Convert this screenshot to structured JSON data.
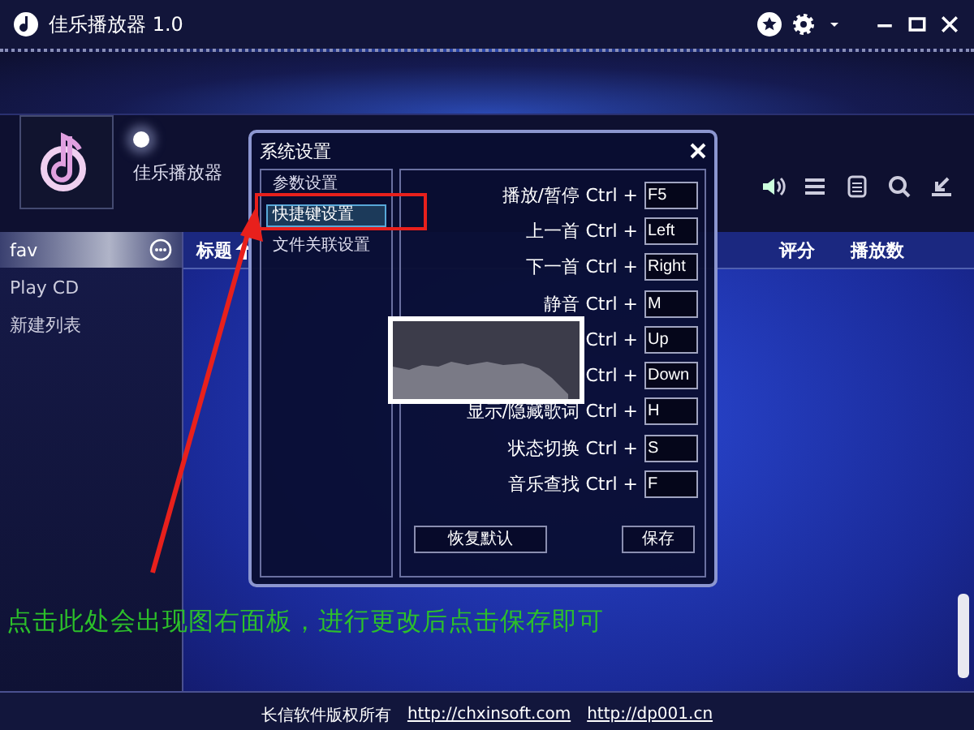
{
  "window": {
    "title": "佳乐播放器 1.0"
  },
  "player": {
    "track_name": "佳乐播放器"
  },
  "playlists": [
    {
      "label": "fav",
      "selected": true
    },
    {
      "label": "Play CD",
      "selected": false
    },
    {
      "label": "新建列表",
      "selected": false
    }
  ],
  "table": {
    "columns": [
      {
        "label": "标题",
        "sorted": true
      },
      {
        "label": "评分",
        "sorted": false
      },
      {
        "label": "播放数",
        "sorted": false
      }
    ]
  },
  "dialog": {
    "title": "系统设置",
    "nav": [
      {
        "label": "参数设置",
        "selected": false
      },
      {
        "label": "快捷键设置",
        "selected": true
      },
      {
        "label": "文件关联设置",
        "selected": false
      }
    ],
    "shortcuts": [
      {
        "label": "播放/暂停",
        "modifier": "Ctrl +",
        "key": "F5"
      },
      {
        "label": "上一首",
        "modifier": "Ctrl +",
        "key": "Left"
      },
      {
        "label": "下一首",
        "modifier": "Ctrl +",
        "key": "Right"
      },
      {
        "label": "静音",
        "modifier": "Ctrl +",
        "key": "M"
      },
      {
        "modifier": "Ctrl +",
        "key": "Up"
      },
      {
        "modifier": "Ctrl +",
        "key": "Down"
      },
      {
        "label": "显示/隐藏歌词",
        "modifier": "Ctrl +",
        "key": "H"
      },
      {
        "label": "状态切换",
        "modifier": "Ctrl +",
        "key": "S"
      },
      {
        "label": "音乐查找",
        "modifier": "Ctrl +",
        "key": "F"
      }
    ],
    "buttons": [
      "恢复默认",
      "保存"
    ]
  },
  "annotation": {
    "text": "点击此处会出现图右面板，进行更改后点击保存即可"
  },
  "footer": {
    "copyright": "长信软件版权所有",
    "links": [
      "http://chxinsoft.com",
      "http://dp001.cn"
    ]
  }
}
